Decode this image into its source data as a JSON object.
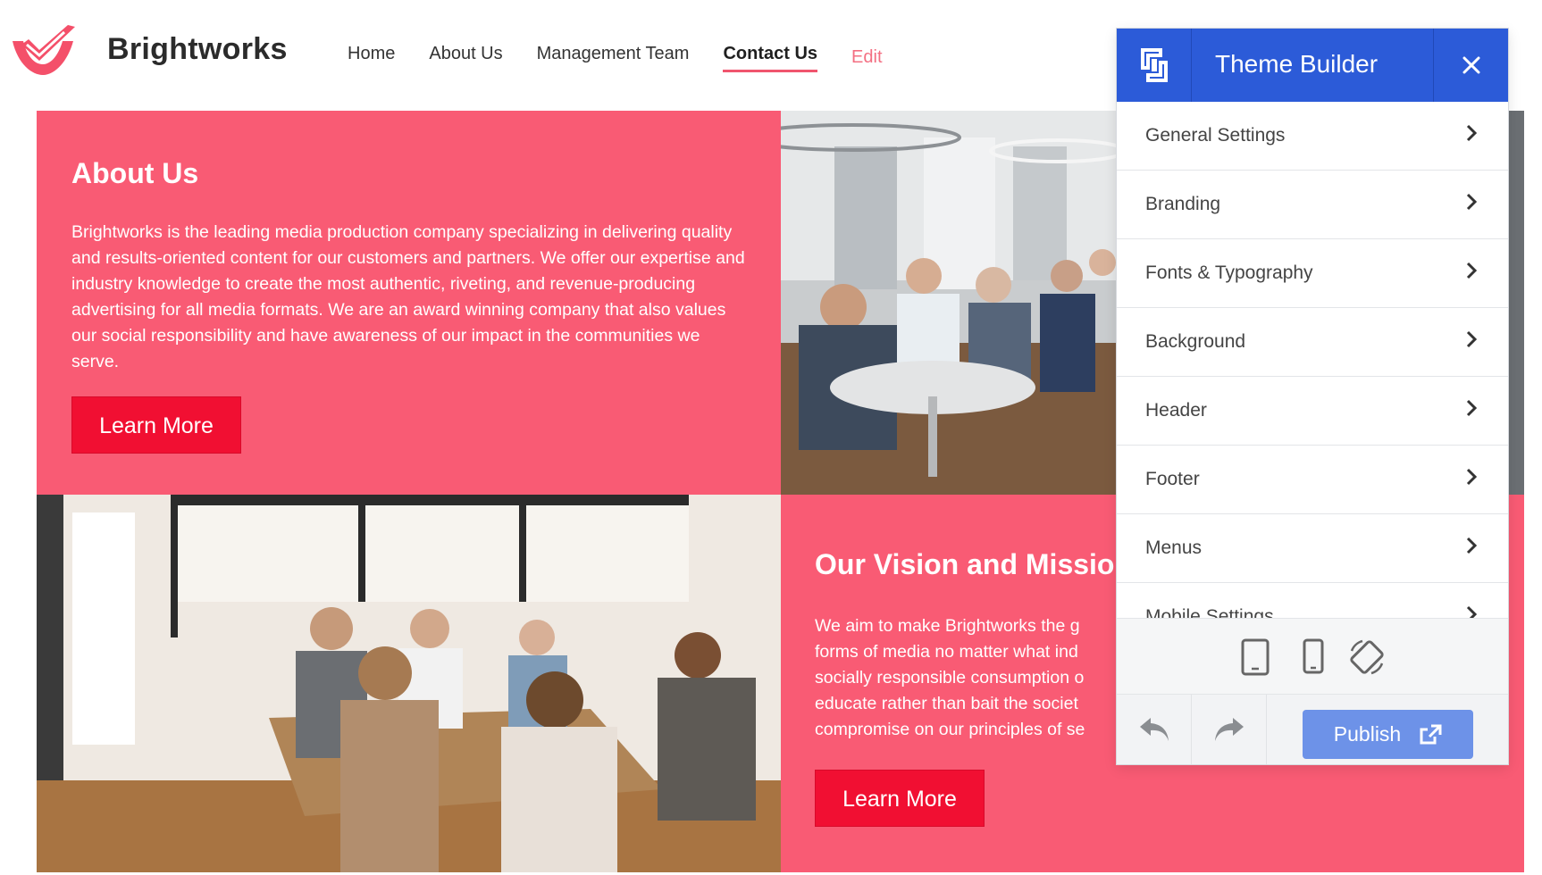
{
  "brand": {
    "name": "Brightworks",
    "accent": "#f95b74"
  },
  "nav": {
    "items": [
      {
        "label": "Home",
        "active": false
      },
      {
        "label": "About Us",
        "active": false
      },
      {
        "label": "Management Team",
        "active": false
      },
      {
        "label": "Contact Us",
        "active": true
      }
    ],
    "edit_label": "Edit"
  },
  "about": {
    "title": "About Us",
    "text": "Brightworks is the leading media production company specializing in delivering quality and results-oriented content for our customers and partners. We offer our expertise and industry knowledge to create the most authentic, riveting, and revenue-producing advertising for all media formats. We are an award winning company that also values our social responsibility and have awareness of our impact in the communities we serve.",
    "button_label": "Learn More"
  },
  "vision": {
    "title": "Our Vision and Mission",
    "lines": [
      "We aim to make Brightworks the g",
      "forms of media no matter what ind",
      "socially responsible consumption o",
      "educate rather than bait the societ",
      "compromise on our principles of se"
    ],
    "button_label": "Learn More"
  },
  "theme_builder": {
    "title": "Theme Builder",
    "items": [
      {
        "label": "General Settings"
      },
      {
        "label": "Branding"
      },
      {
        "label": "Fonts & Typography"
      },
      {
        "label": "Background"
      },
      {
        "label": "Header"
      },
      {
        "label": "Footer"
      },
      {
        "label": "Menus"
      },
      {
        "label": "Mobile Settings"
      }
    ],
    "devices": [
      "tablet-icon",
      "phone-icon",
      "rotate-icon"
    ],
    "publish_label": "Publish",
    "colors": {
      "header": "#2c5bd8",
      "publish": "#6d92e8"
    }
  }
}
